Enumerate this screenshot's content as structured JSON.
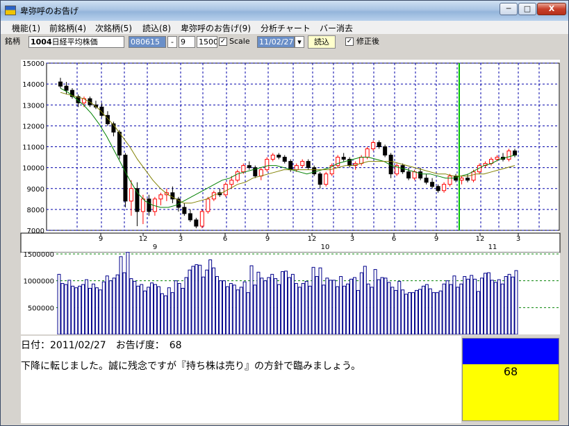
{
  "window": {
    "title": "卑弥呼のお告げ",
    "min_label": "─",
    "max_label": "□",
    "close_label": "X"
  },
  "menu": [
    {
      "label": "機能(1)"
    },
    {
      "label": "前銘柄(4)"
    },
    {
      "label": "次銘柄(5)"
    },
    {
      "label": "読込(8)"
    },
    {
      "label": "卑弥呼のお告げ(9)"
    },
    {
      "label": "分析チャート"
    },
    {
      "label": "バー消去"
    }
  ],
  "toolbar": {
    "symbol_label": "銘柄",
    "code": "1004",
    "name": "日経平均株価",
    "date_field": "080615",
    "small_btn": "-",
    "field_a": "9",
    "field_b": "1500",
    "scale_label": "Scale",
    "scale_checked": "✓",
    "date_select": "11/02/27",
    "load_button": "読込",
    "adjusted_label": "修正後",
    "adjusted_checked": "✓"
  },
  "info": {
    "date_line": "日付：2011/02/27　お告げ度：　68",
    "message": "下降に転じました。誠に残念ですが『持ち株は売り』の方針で臨みましょう。"
  },
  "gauge": {
    "value": 68,
    "label": "68",
    "fill_fraction": 0.31
  },
  "colors": {
    "up": "#ff0000",
    "down": "#000000",
    "ma_short": "#008000",
    "ma_long": "#808000",
    "volume": "#00008b",
    "grid": "#0000aa",
    "marker": "#00c000"
  },
  "chart_data": [
    {
      "type": "candlestick",
      "title": "",
      "ylim": [
        7000,
        15000
      ],
      "yticks": [
        7000,
        8000,
        9000,
        10000,
        11000,
        12000,
        13000,
        14000,
        15000
      ],
      "x_tick_labels": [
        "9",
        "12",
        "3",
        "6",
        "9",
        "12",
        "3",
        "6",
        "9",
        "12",
        "3"
      ],
      "x_group_labels": [
        "9",
        "10",
        "11"
      ],
      "marker_line_label": "",
      "series": [
        {
          "name": "",
          "kind": "ohlc",
          "values": [
            [
              14100,
              14300,
              13800,
              13900
            ],
            [
              13900,
              14100,
              13500,
              13700
            ],
            [
              13700,
              13800,
              13300,
              13400
            ],
            [
              13400,
              13500,
              12900,
              13100
            ],
            [
              13100,
              13400,
              12900,
              13300
            ],
            [
              13300,
              13400,
              12900,
              13000
            ],
            [
              13000,
              13200,
              12800,
              12900
            ],
            [
              12900,
              13100,
              12400,
              12500
            ],
            [
              12500,
              12700,
              12000,
              12100
            ],
            [
              12100,
              12200,
              11500,
              11700
            ],
            [
              11700,
              11800,
              10400,
              10600
            ],
            [
              10600,
              10700,
              8100,
              8400
            ],
            [
              8400,
              9400,
              7700,
              9000
            ],
            [
              9000,
              9300,
              7200,
              7900
            ],
            [
              7900,
              8700,
              7300,
              8500
            ],
            [
              8500,
              8700,
              7700,
              7900
            ],
            [
              7900,
              8600,
              7700,
              8500
            ],
            [
              8500,
              8800,
              8200,
              8700
            ],
            [
              8700,
              9000,
              8400,
              8800
            ],
            [
              8800,
              9100,
              8300,
              8500
            ],
            [
              8500,
              8600,
              7900,
              8100
            ],
            [
              8100,
              8300,
              7700,
              7800
            ],
            [
              7800,
              8000,
              7400,
              7500
            ],
            [
              7500,
              7600,
              7100,
              7200
            ],
            [
              7200,
              8000,
              7100,
              7900
            ],
            [
              7900,
              8600,
              7800,
              8500
            ],
            [
              8500,
              8900,
              8400,
              8800
            ],
            [
              8800,
              9000,
              8600,
              8700
            ],
            [
              8700,
              9300,
              8600,
              9200
            ],
            [
              9200,
              9600,
              9000,
              9400
            ],
            [
              9400,
              9900,
              9300,
              9800
            ],
            [
              9800,
              10200,
              9700,
              10100
            ],
            [
              10100,
              10300,
              9900,
              10000
            ],
            [
              10000,
              10100,
              9500,
              9600
            ],
            [
              9600,
              10000,
              9400,
              9900
            ],
            [
              9900,
              10500,
              9800,
              10400
            ],
            [
              10400,
              10700,
              10300,
              10600
            ],
            [
              10600,
              10700,
              10400,
              10500
            ],
            [
              10500,
              10600,
              10200,
              10300
            ],
            [
              10300,
              10400,
              9800,
              9900
            ],
            [
              9900,
              10200,
              9800,
              10100
            ],
            [
              10100,
              10400,
              10000,
              10300
            ],
            [
              10300,
              10400,
              9900,
              10000
            ],
            [
              10000,
              10100,
              9600,
              9700
            ],
            [
              9700,
              9800,
              9000,
              9200
            ],
            [
              9200,
              9800,
              9100,
              9700
            ],
            [
              9700,
              10200,
              9600,
              10100
            ],
            [
              10100,
              10600,
              10000,
              10500
            ],
            [
              10500,
              10700,
              10300,
              10400
            ],
            [
              10400,
              10500,
              10000,
              10100
            ],
            [
              10100,
              10300,
              9900,
              10200
            ],
            [
              10200,
              10600,
              10100,
              10500
            ],
            [
              10500,
              11000,
              10400,
              10900
            ],
            [
              10900,
              11300,
              10800,
              11200
            ],
            [
              11200,
              11300,
              10900,
              11000
            ],
            [
              11000,
              11100,
              10500,
              10600
            ],
            [
              10600,
              10700,
              9500,
              9700
            ],
            [
              9700,
              10200,
              9600,
              10100
            ],
            [
              10100,
              10200,
              9700,
              9800
            ],
            [
              9800,
              10000,
              9400,
              9500
            ],
            [
              9500,
              9900,
              9400,
              9800
            ],
            [
              9800,
              10000,
              9400,
              9500
            ],
            [
              9500,
              9700,
              9200,
              9300
            ],
            [
              9300,
              9500,
              9000,
              9100
            ],
            [
              9100,
              9200,
              8800,
              8900
            ],
            [
              8900,
              9300,
              8800,
              9200
            ],
            [
              9200,
              9700,
              9100,
              9600
            ],
            [
              9600,
              9700,
              9300,
              9400
            ],
            [
              9400,
              9600,
              9200,
              9500
            ],
            [
              9500,
              9700,
              9300,
              9400
            ],
            [
              9400,
              9900,
              9300,
              9800
            ],
            [
              9800,
              10200,
              9700,
              10100
            ],
            [
              10100,
              10300,
              10000,
              10200
            ],
            [
              10200,
              10500,
              10100,
              10400
            ],
            [
              10400,
              10600,
              10300,
              10500
            ],
            [
              10500,
              10700,
              10300,
              10400
            ],
            [
              10400,
              10900,
              10300,
              10800
            ],
            [
              10800,
              10900,
              10500,
              10600
            ]
          ]
        },
        {
          "name": "",
          "kind": "ma_short",
          "values": [
            13800,
            13600,
            13300,
            13000,
            12600,
            12100,
            11500,
            10800,
            10100,
            9400,
            8800,
            8400,
            8200,
            8100,
            8100,
            8200,
            8400,
            8600,
            8800,
            9000,
            9200,
            9400,
            9500,
            9700,
            9800,
            9900,
            10000,
            10100,
            10100,
            10000,
            9900,
            9800,
            9700,
            9800,
            9900,
            10000,
            10200,
            10300,
            10400,
            10500,
            10500,
            10400,
            10300,
            10100,
            10000,
            9900,
            9800,
            9700,
            9700,
            9600,
            9500,
            9500,
            9600,
            9700,
            9900,
            10100,
            10200,
            10400,
            10500,
            10600
          ]
        },
        {
          "name": "",
          "kind": "ma_long",
          "values": [
            13600,
            13500,
            13400,
            13300,
            13100,
            12800,
            12400,
            12000,
            11500,
            11000,
            10400,
            9900,
            9400,
            9000,
            8700,
            8500,
            8300,
            8300,
            8400,
            8500,
            8700,
            8800,
            9000,
            9200,
            9300,
            9500,
            9600,
            9700,
            9800,
            9900,
            9900,
            9900,
            9900,
            9900,
            9900,
            9900,
            10000,
            10100,
            10100,
            10200,
            10300,
            10300,
            10300,
            10300,
            10200,
            10100,
            10000,
            9900,
            9800,
            9700,
            9700,
            9600,
            9600,
            9600,
            9700,
            9700,
            9800,
            9900,
            10000,
            10100
          ]
        }
      ]
    },
    {
      "type": "bar",
      "title": "",
      "ylim": [
        0,
        1500000
      ],
      "yticks_labels": [
        "1500000",
        "1000000",
        "500000"
      ],
      "series": [
        {
          "name": "",
          "values": [
            1120000,
            950000,
            930000,
            1010000,
            900000,
            870000,
            900000,
            930000,
            1020000,
            860000,
            940000,
            870000,
            830000,
            980000,
            1090000,
            1000000,
            1050000,
            1110000,
            1450000,
            1150000,
            1530000,
            1040000,
            990000,
            900000,
            930000,
            810000,
            880000,
            960000,
            930000,
            890000,
            760000,
            720000,
            870000,
            780000,
            1000000,
            950000,
            860000,
            1060000,
            1200000,
            1270000,
            1300000,
            1290000,
            1070000,
            1200000,
            1390000,
            1240000,
            1080000,
            1000000,
            1000000,
            890000,
            950000,
            920000,
            830000,
            880000,
            980000,
            780000,
            1280000,
            920000,
            1160000,
            1050000,
            1000000,
            1060000,
            1120000,
            1040000,
            930000,
            1170000,
            1180000,
            1060000,
            1120000,
            950000,
            880000,
            950000,
            990000,
            900000,
            1250000,
            1080000,
            1240000,
            920000,
            1050000,
            1010000,
            1010000,
            890000,
            1080000,
            900000,
            940000,
            1030000,
            1060000,
            820000,
            1150000,
            1270000,
            940000,
            880000,
            1210000,
            1020000,
            1060000,
            1050000,
            970000,
            880000,
            820000,
            990000,
            830000,
            750000,
            780000,
            780000,
            820000,
            840000,
            900000,
            930000,
            850000,
            780000,
            780000,
            810000,
            940000,
            1000000,
            930000,
            1090000,
            880000,
            940000,
            1080000,
            1030000,
            1100000,
            1030000,
            800000,
            1050000,
            1140000,
            1150000,
            1010000,
            970000,
            1020000,
            940000,
            1080000,
            1120000,
            1070000,
            1190000
          ]
        }
      ]
    }
  ]
}
